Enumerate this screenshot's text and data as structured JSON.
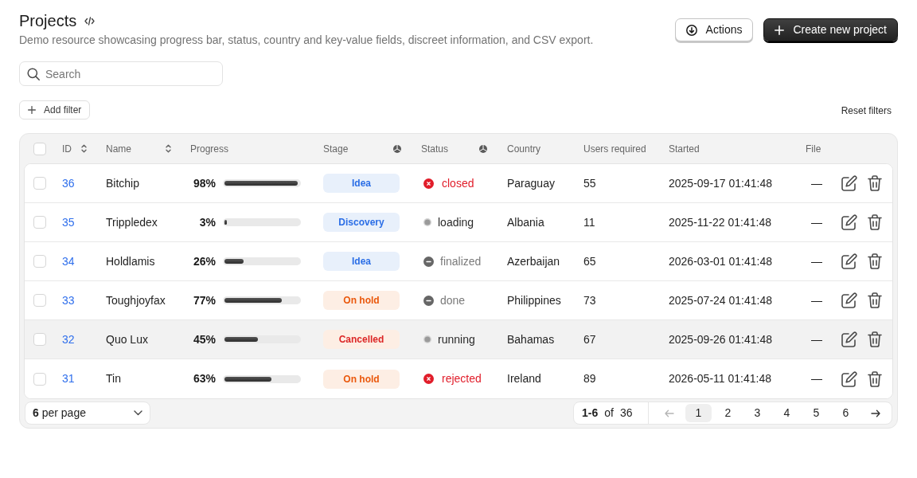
{
  "header": {
    "title": "Projects",
    "description": "Demo resource showcasing progress bar, status, country and key-value fields, discreet information, and CSV export."
  },
  "actions": [
    {
      "label": "Actions",
      "kind": "secondary"
    },
    {
      "label": "Create new project",
      "kind": "primary"
    }
  ],
  "search": {
    "placeholder": "Search"
  },
  "filters": {
    "add_label": "Add filter",
    "reset_label": "Reset filters"
  },
  "table": {
    "select_all_checked": false,
    "columns": [
      {
        "label": "ID",
        "kind": "sortable"
      },
      {
        "label": "Name",
        "kind": "sortable"
      },
      {
        "label": "Progress",
        "kind": "plain"
      },
      {
        "label": "Stage",
        "kind": "filterable"
      },
      {
        "label": "Status",
        "kind": "filterable"
      },
      {
        "label": "Country",
        "kind": "plain"
      },
      {
        "label": "Users required",
        "kind": "plain"
      },
      {
        "label": "Started",
        "kind": "plain"
      },
      {
        "label": "File",
        "kind": "plain"
      }
    ],
    "rows": [
      {
        "checked": false,
        "hovered": false,
        "id": "36",
        "name": "Bitchip",
        "progress": {
          "reading": "98%",
          "level": 0.98
        },
        "stage": {
          "label": "Idea",
          "kind": "info"
        },
        "status": {
          "label": "closed",
          "kind": "error"
        },
        "country": "Paraguay",
        "users_required": "55",
        "started": "2025-09-17 01:41:48",
        "file": "—"
      },
      {
        "checked": false,
        "hovered": false,
        "id": "35",
        "name": "Trippledex",
        "progress": {
          "reading": "3%",
          "level": 0.03
        },
        "stage": {
          "label": "Discovery",
          "kind": "info"
        },
        "status": {
          "label": "loading",
          "kind": "pending"
        },
        "country": "Albania",
        "users_required": "11",
        "started": "2025-11-22 01:41:48",
        "file": "—"
      },
      {
        "checked": false,
        "hovered": false,
        "id": "34",
        "name": "Holdlamis",
        "progress": {
          "reading": "26%",
          "level": 0.26
        },
        "stage": {
          "label": "Idea",
          "kind": "info"
        },
        "status": {
          "label": "finalized",
          "kind": "inactive"
        },
        "country": "Azerbaijan",
        "users_required": "65",
        "started": "2026-03-01 01:41:48",
        "file": "—"
      },
      {
        "checked": false,
        "hovered": false,
        "id": "33",
        "name": "Toughjoyfax",
        "progress": {
          "reading": "77%",
          "level": 0.77
        },
        "stage": {
          "label": "On hold",
          "kind": "warning"
        },
        "status": {
          "label": "done",
          "kind": "inactive"
        },
        "country": "Philippines",
        "users_required": "73",
        "started": "2025-07-24 01:41:48",
        "file": "—"
      },
      {
        "checked": false,
        "hovered": true,
        "id": "32",
        "name": "Quo Lux",
        "progress": {
          "reading": "45%",
          "level": 0.45
        },
        "stage": {
          "label": "Cancelled",
          "kind": "danger"
        },
        "status": {
          "label": "running",
          "kind": "pending"
        },
        "country": "Bahamas",
        "users_required": "67",
        "started": "2025-09-26 01:41:48",
        "file": "—"
      },
      {
        "checked": false,
        "hovered": false,
        "id": "31",
        "name": "Tin",
        "progress": {
          "reading": "63%",
          "level": 0.63
        },
        "stage": {
          "label": "On hold",
          "kind": "warning"
        },
        "status": {
          "label": "rejected",
          "kind": "error"
        },
        "country": "Ireland",
        "users_required": "89",
        "started": "2026-05-11 01:41:48",
        "file": "—"
      }
    ]
  },
  "footer": {
    "per_page": "**6** per page",
    "range": "1-6",
    "of": "of",
    "total": "36",
    "prev_disabled": true,
    "pages": [
      {
        "label": "1",
        "selected": true
      },
      {
        "label": "2",
        "selected": false
      },
      {
        "label": "3",
        "selected": false
      },
      {
        "label": "4",
        "selected": false
      },
      {
        "label": "5",
        "selected": false
      },
      {
        "label": "6",
        "selected": false
      }
    ]
  }
}
